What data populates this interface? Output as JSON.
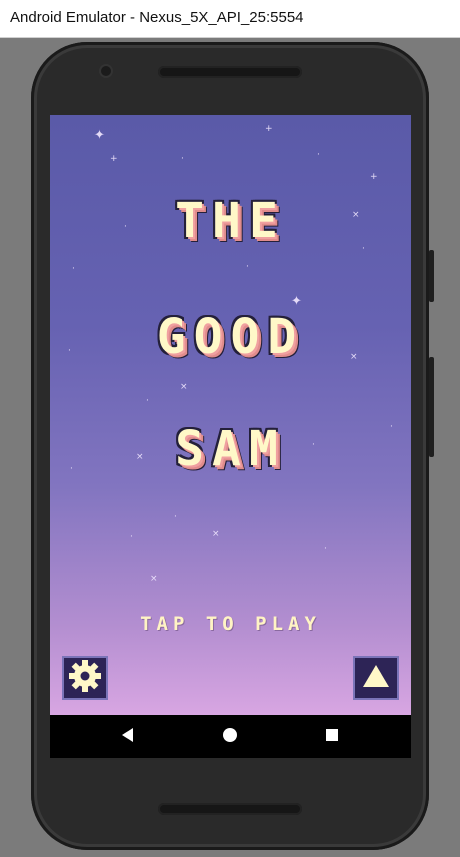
{
  "window": {
    "title": "Android Emulator - Nexus_5X_API_25:5554"
  },
  "game": {
    "title_lines": [
      "THE",
      "GOOD",
      "SAM"
    ],
    "tap_prompt": "TAP TO PLAY",
    "settings_icon": "gear-icon",
    "leaderboard_icon": "triangle-up-icon"
  },
  "navbar": {
    "back_icon": "back-triangle-icon",
    "home_icon": "home-circle-icon",
    "recents_icon": "recents-square-icon"
  },
  "colors": {
    "title_fill": "#fff8c8",
    "title_shadow": "#e08c8c",
    "sky_top": "#5a5aa8",
    "sky_bottom": "#d8a6e2",
    "button_bg": "#2d2456"
  }
}
